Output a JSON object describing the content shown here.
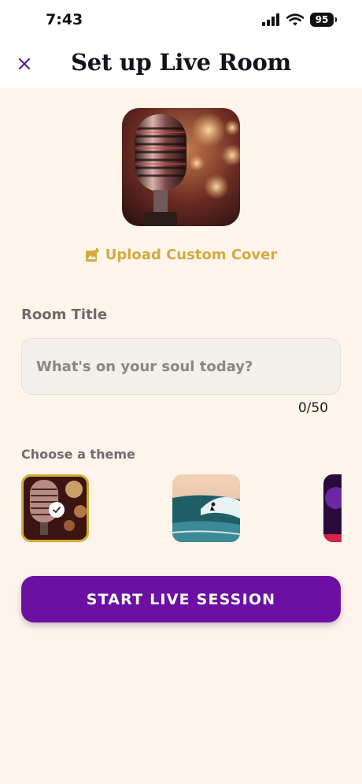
{
  "status_bar": {
    "time": "7:43",
    "battery": "95"
  },
  "header": {
    "title": "Set up Live Room",
    "close_icon": "close-icon"
  },
  "cover": {
    "icon": "microphone-image",
    "upload_label": "Upload Custom Cover",
    "upload_icon": "add-image-icon"
  },
  "room_title": {
    "label": "Room Title",
    "placeholder": "What's on your soul today?",
    "value": "",
    "counter": "0/50"
  },
  "theme": {
    "label": "Choose a theme",
    "options": [
      {
        "name": "microphone",
        "selected": true
      },
      {
        "name": "surfer-wave",
        "selected": false
      },
      {
        "name": "purple-stage",
        "selected": false
      }
    ]
  },
  "start_button": {
    "label": "START LIVE SESSION"
  },
  "colors": {
    "accent": "#6c10a3",
    "gold": "#d4aa3c",
    "background": "#fdf5ec"
  }
}
